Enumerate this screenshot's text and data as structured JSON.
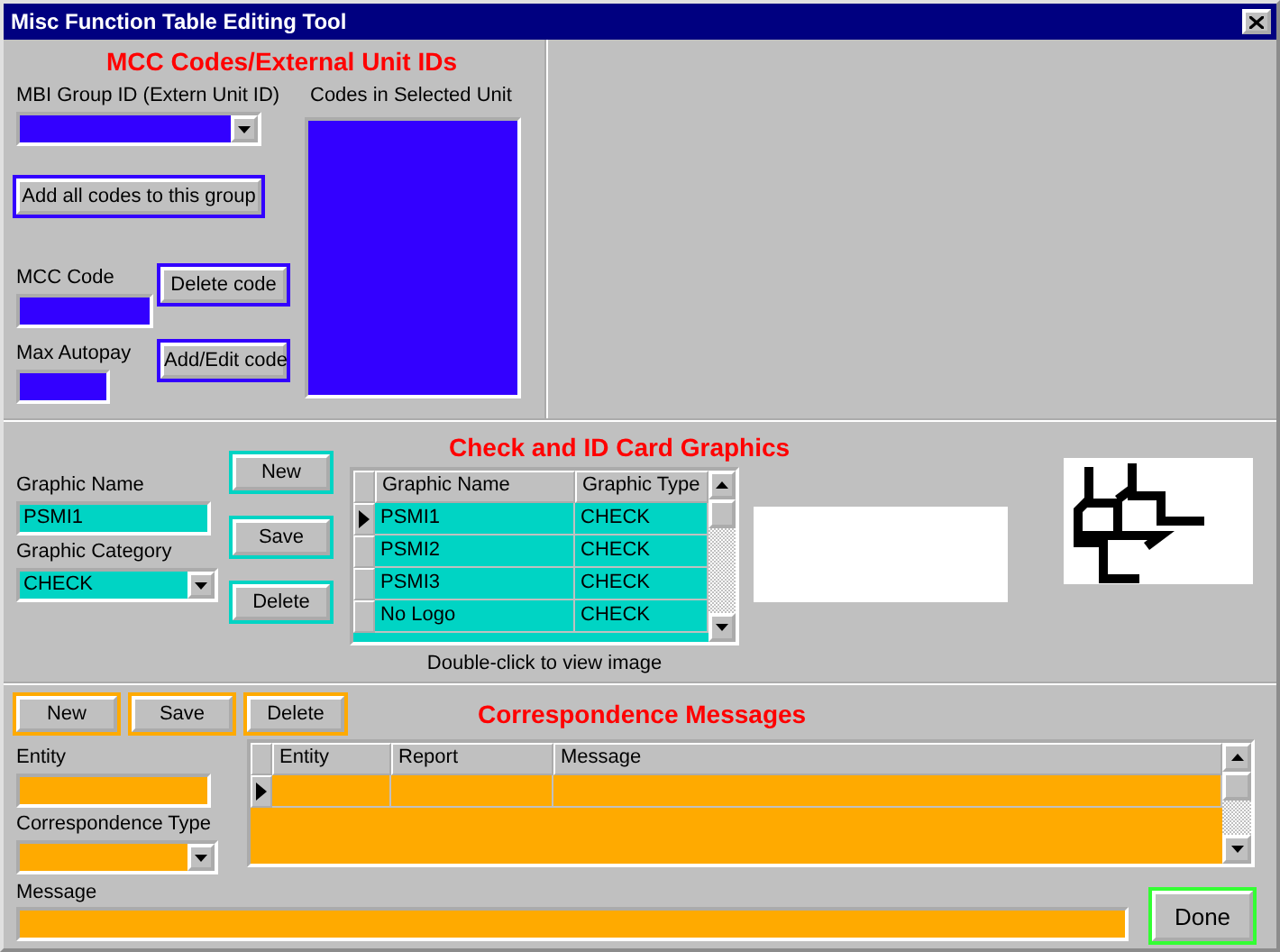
{
  "window": {
    "title": "Misc Function Table Editing Tool"
  },
  "mcc": {
    "heading": "MCC Codes/External Unit IDs",
    "group_label": "MBI Group ID (Extern Unit ID)",
    "add_all_button": "Add all codes to this group",
    "codes_label": "Codes in Selected Unit",
    "mcc_label": "MCC Code",
    "delete_button": "Delete code",
    "autopay_label": "Max Autopay",
    "add_edit_button": "Add/Edit code"
  },
  "graphics": {
    "heading": "Check and ID Card Graphics",
    "name_label": "Graphic Name",
    "name_value": "PSMI1",
    "category_label": "Graphic Category",
    "category_value": "CHECK",
    "buttons": [
      "New",
      "Save",
      "Delete"
    ],
    "columns": [
      "Graphic Name",
      "Graphic Type"
    ],
    "rows": [
      {
        "cells": [
          "PSMI1",
          "CHECK"
        ],
        "selected": true
      },
      {
        "cells": [
          "PSMI2",
          "CHECK"
        ],
        "selected": false
      },
      {
        "cells": [
          "PSMI3",
          "CHECK"
        ],
        "selected": false
      },
      {
        "cells": [
          "No Logo",
          "CHECK"
        ],
        "selected": false
      }
    ],
    "hint": "Double-click to view image"
  },
  "correspondence": {
    "buttons": [
      "New",
      "Save",
      "Delete"
    ],
    "heading": "Correspondence Messages",
    "entity_label": "Entity",
    "type_label": "Correspondence Type",
    "columns": [
      "Entity",
      "Report",
      "Message"
    ],
    "rows": [
      {
        "cells": [
          "",
          "",
          ""
        ],
        "selected": true
      }
    ],
    "message_label": "Message",
    "done_button": "Done"
  }
}
